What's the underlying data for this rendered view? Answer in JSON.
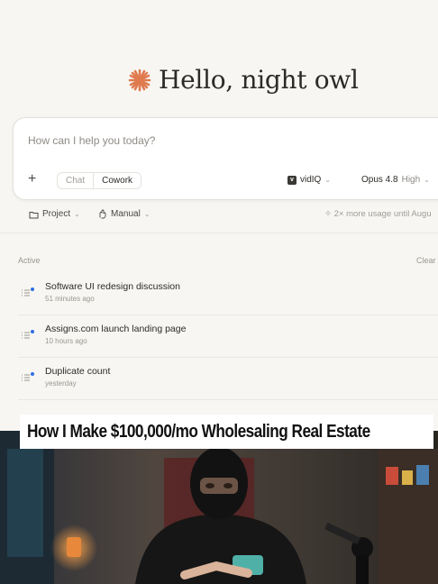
{
  "greeting": {
    "text": "Hello, night owl",
    "icon": "sparkle-icon",
    "accent": "#e07a4f"
  },
  "composer": {
    "placeholder": "How can I help you today?",
    "mode_chat": "Chat",
    "mode_cowork": "Cowork",
    "connector": "vidIQ",
    "model": "Opus 4.8",
    "effort": "High"
  },
  "subbar": {
    "project": "Project",
    "manual": "Manual",
    "usage": "2× more usage until Augu"
  },
  "list": {
    "section": "Active",
    "clear": "Clear",
    "items": [
      {
        "title": "Software UI redesign discussion",
        "time": "51 minutes ago"
      },
      {
        "title": "Assigns.com launch landing page",
        "time": "10 hours ago"
      },
      {
        "title": "Duplicate count",
        "time": "yesterday"
      }
    ]
  },
  "overlay": {
    "banner": "How I Make $100,000/mo Wholesaling Real Estate"
  }
}
